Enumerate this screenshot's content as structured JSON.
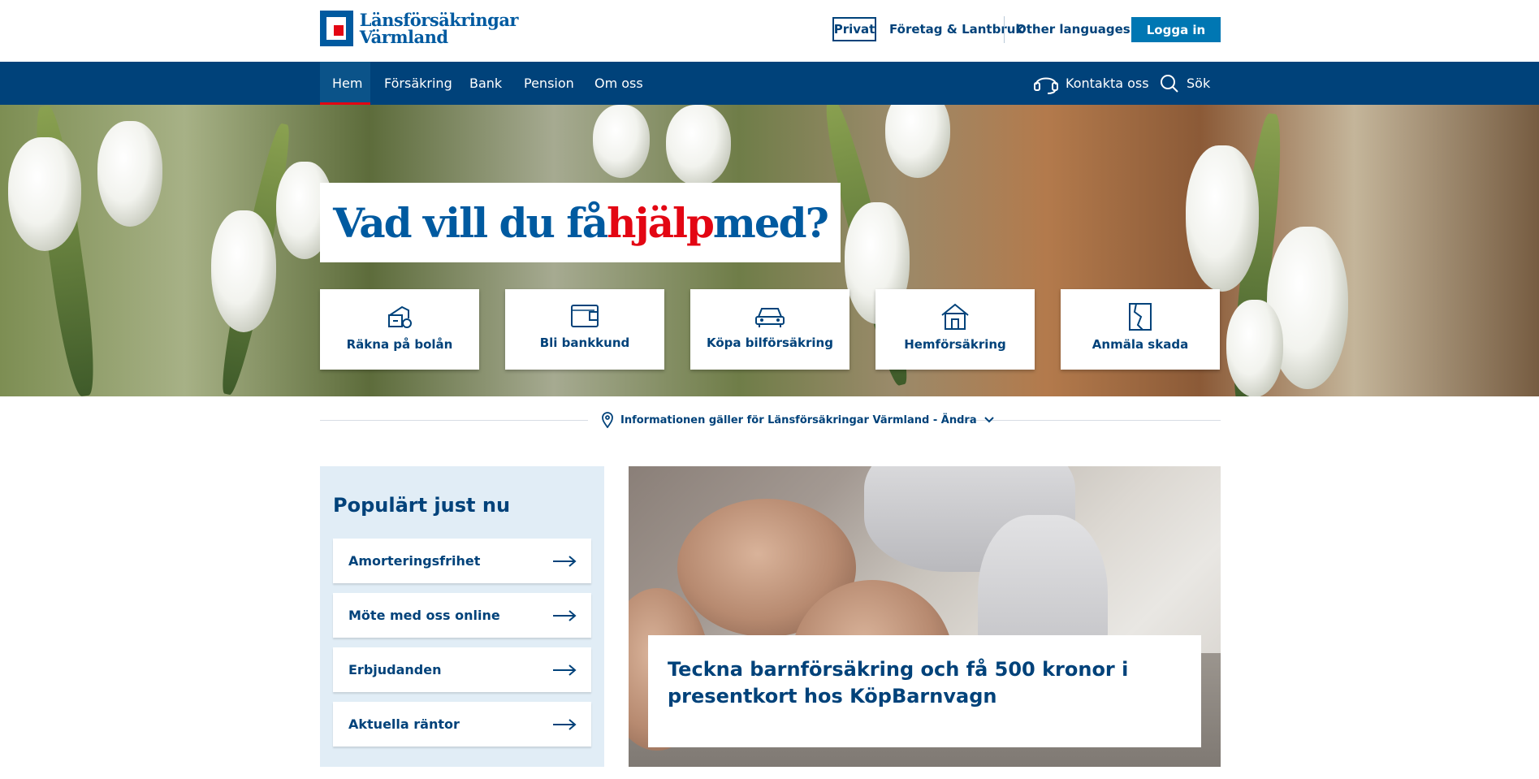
{
  "brand": {
    "name_line1": "Länsförsäkringar",
    "name_line2": "Värmland",
    "logo_colors": {
      "blue": "#005aa0",
      "red": "#e30613"
    }
  },
  "topbar": {
    "privat": "Privat",
    "foretag": "Företag & Lantbruk",
    "languages": "Other languages",
    "login": "Logga in"
  },
  "nav": {
    "items": [
      {
        "label": "Hem",
        "active": true
      },
      {
        "label": "Försäkring"
      },
      {
        "label": "Bank"
      },
      {
        "label": "Pension"
      },
      {
        "label": "Om oss"
      }
    ],
    "contact": {
      "label": "Kontakta oss",
      "icon": "headset-icon"
    },
    "search": {
      "label": "Sök",
      "icon": "search-icon"
    }
  },
  "hero": {
    "headline_part1": "Vad vill du få ",
    "headline_highlight": "hjälp",
    "headline_part2": " med?",
    "tiles": [
      {
        "label": "Räkna på bolån",
        "icon": "house-calculator-icon"
      },
      {
        "label": "Bli bankkund",
        "icon": "wallet-icon"
      },
      {
        "label": "Köpa bilförsäkring",
        "icon": "car-icon"
      },
      {
        "label": "Hemförsäkring",
        "icon": "house-icon"
      },
      {
        "label": "Anmäla skada",
        "icon": "damage-report-icon"
      }
    ]
  },
  "region_info": {
    "text": "Informationen gäller för Länsförsäkringar Värmland - Ändra",
    "icon": "location-pin-icon"
  },
  "popular": {
    "title": "Populärt just nu",
    "items": [
      {
        "label": "Amorteringsfrihet"
      },
      {
        "label": "Möte med oss online"
      },
      {
        "label": "Erbjudanden"
      },
      {
        "label": "Aktuella räntor"
      }
    ]
  },
  "feature": {
    "text": "Teckna barnförsäkring och få 500 kronor i presentkort hos KöpBarnvagn"
  },
  "colors": {
    "primary": "#00427a",
    "accent": "#0077b3",
    "red": "#e30613",
    "panel": "#e1edf6"
  }
}
